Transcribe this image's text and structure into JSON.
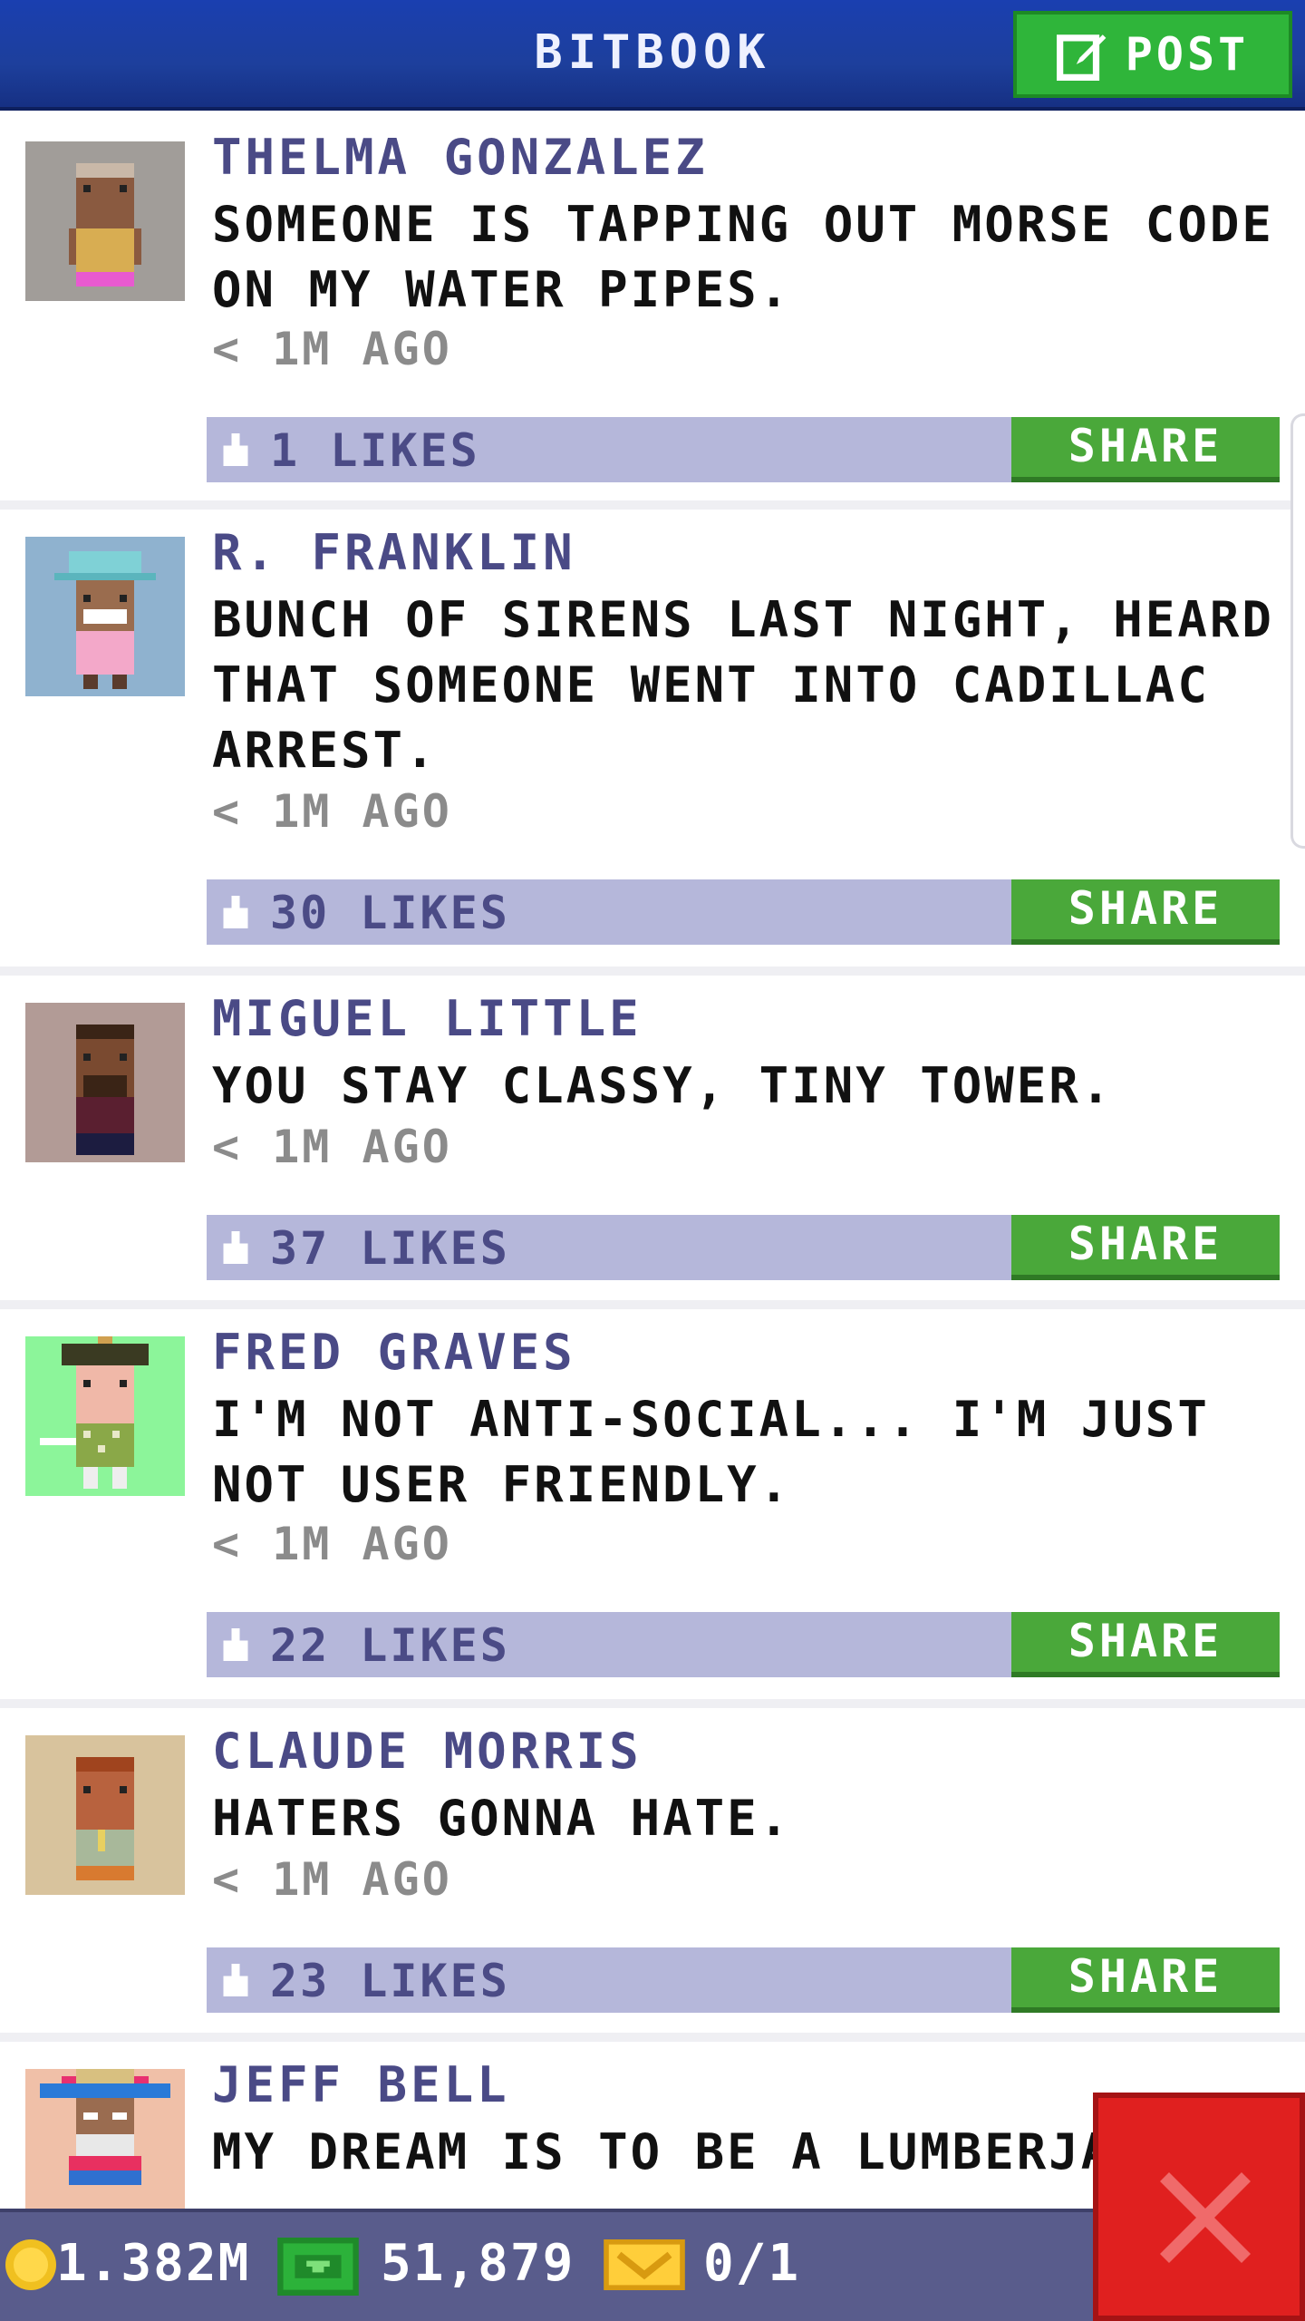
{
  "header": {
    "title": "BITBOOK",
    "post_label": "POST"
  },
  "posts": [
    {
      "author": "THELMA GONZALEZ",
      "message": "SOMEONE IS TAPPING OUT MORSE CODE ON MY WATER PIPES.",
      "time": "< 1M AGO",
      "likes": "1 LIKES",
      "share": "SHARE"
    },
    {
      "author": "R. FRANKLIN",
      "message": "BUNCH OF SIRENS LAST NIGHT, HEARD THAT SOMEONE WENT INTO CADILLAC ARREST.",
      "time": "< 1M AGO",
      "likes": "30 LIKES",
      "share": "SHARE"
    },
    {
      "author": "MIGUEL LITTLE",
      "message": "YOU STAY CLASSY, TINY TOWER.",
      "time": "< 1M AGO",
      "likes": "37 LIKES",
      "share": "SHARE"
    },
    {
      "author": "FRED GRAVES",
      "message": "I'M NOT ANTI-SOCIAL... I'M JUST NOT USER FRIENDLY.",
      "time": "< 1M AGO",
      "likes": "22 LIKES",
      "share": "SHARE"
    },
    {
      "author": "CLAUDE MORRIS",
      "message": "HATERS GONNA HATE.",
      "time": "< 1M AGO",
      "likes": "23 LIKES",
      "share": "SHARE"
    },
    {
      "author": "JEFF BELL",
      "message": "MY DREAM IS TO BE A LUMBERJA"
    }
  ],
  "status": {
    "coins": "1.382M",
    "cash": "51,879",
    "bux": "0/1"
  },
  "colors": {
    "header_blue": "#1d3f9c",
    "post_green": "#2fb53a",
    "likes_bar": "#b5b7da",
    "share_green": "#4aa83a",
    "status_bar": "#595c8c",
    "close_red": "#e0201f"
  },
  "icons": [
    "post-edit-icon",
    "like-icon",
    "coin-icon",
    "cash-icon",
    "bux-icon",
    "close-icon"
  ]
}
